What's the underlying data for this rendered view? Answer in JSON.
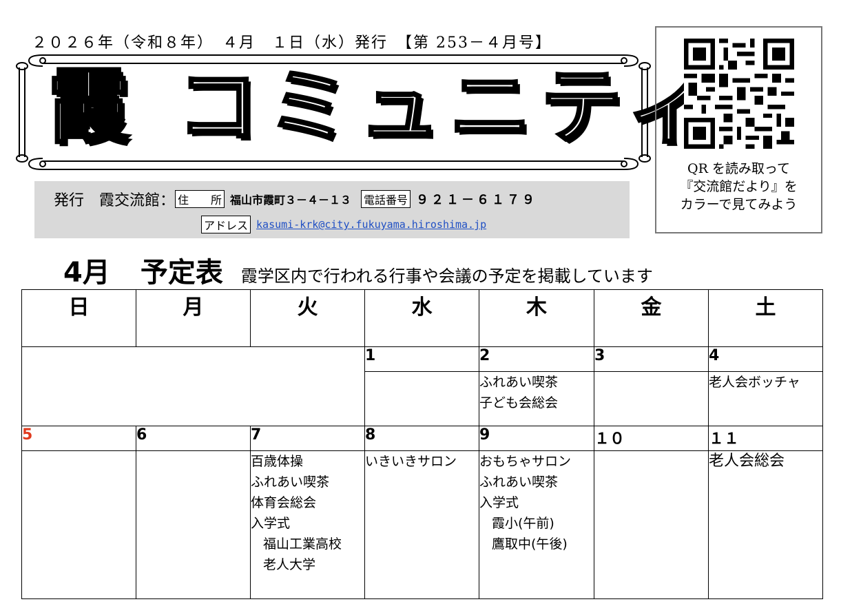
{
  "header": {
    "issue_line": "２０２６年（令和８年）　４月　１日（水）発行　【第 253－４月号】",
    "title": "霞 コミュニティ"
  },
  "publisher": {
    "prefix": "発行　霞交流館：",
    "address_label": "住　　所",
    "address": "福山市霞町３－４－１３",
    "phone_label": "電話番号",
    "phone": "９２１－６１７９",
    "email_label": "アドレス",
    "email": "kasumi-krk@city.fukuyama.hiroshima.jp"
  },
  "qr": {
    "line1": "QR を読み取って",
    "line2": "『交流館だより』を",
    "line3": "カラーで見てみよう"
  },
  "schedule": {
    "month": "4月",
    "title": "予定表",
    "subtitle": "霞学区内で行われる行事や会議の予定を掲載しています"
  },
  "calendar": {
    "weekdays": [
      "日",
      "月",
      "火",
      "水",
      "木",
      "金",
      "土"
    ],
    "week1": {
      "dates": [
        "",
        "",
        "",
        "1",
        "2",
        "3",
        "4"
      ],
      "events": {
        "thu": [
          "ふれあい喫茶",
          "子ども会総会"
        ],
        "sat": [
          "老人会ボッチャ"
        ]
      }
    },
    "week2": {
      "dates": [
        "5",
        "6",
        "7",
        "8",
        "9",
        "１０",
        "１１"
      ],
      "events": {
        "tue": [
          "百歳体操",
          "ふれあい喫茶",
          "体育会総会",
          "入学式",
          "福山工業高校",
          "老人大学"
        ],
        "wed": [
          "いきいきサロン"
        ],
        "thu": [
          "おもちゃサロン",
          "ふれあい喫茶",
          "入学式",
          "霞小(午前)",
          "鷹取中(午後)"
        ],
        "sat": [
          "老人会総会"
        ]
      }
    }
  },
  "colors": {
    "sunday": "#e03a1e",
    "link": "#1f4fc4",
    "band": "#d9d9d9"
  }
}
